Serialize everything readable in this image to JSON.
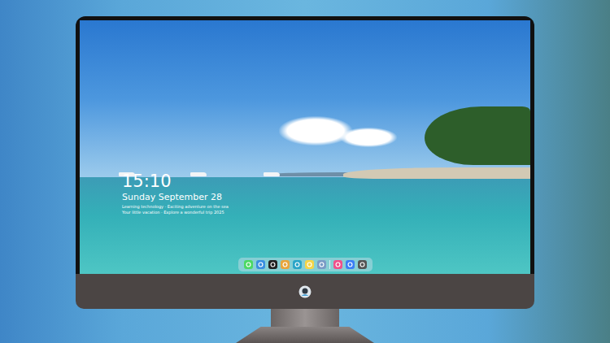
{
  "lock_screen": {
    "time": "15:10",
    "date": "Sunday September 28",
    "caption": [
      "Learning technology · Exciting adventure on the sea",
      "Your little vacation · Explore a wonderful trip 2025"
    ]
  },
  "dock": {
    "items": [
      {
        "kind": "app",
        "color": "#4cd964"
      },
      {
        "kind": "app",
        "color": "#3a8fe0"
      },
      {
        "kind": "app",
        "color": "#222222"
      },
      {
        "kind": "app",
        "color": "#e8a53c"
      },
      {
        "kind": "app",
        "color": "#2aa5c8"
      },
      {
        "kind": "app",
        "color": "#f5d547"
      },
      {
        "kind": "app",
        "color": "#7a9cc6"
      },
      {
        "kind": "separator"
      },
      {
        "kind": "app",
        "color": "#f0508a"
      },
      {
        "kind": "app",
        "color": "#3b7ff5"
      },
      {
        "kind": "app",
        "color": "#555555"
      }
    ]
  }
}
